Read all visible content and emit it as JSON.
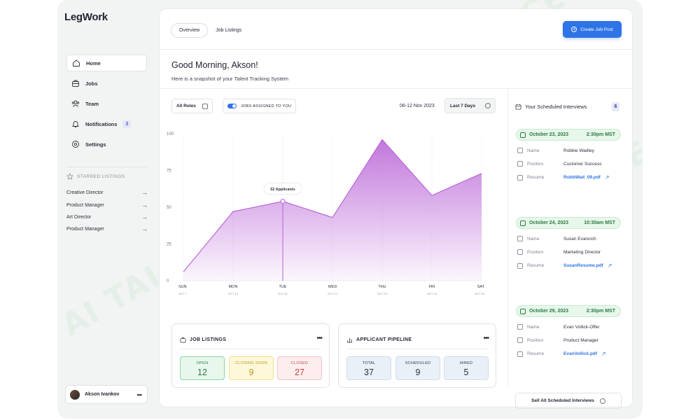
{
  "app": {
    "logo": "LegWork"
  },
  "watermark": "AI TALENT SPACE",
  "sidebar": {
    "nav": [
      {
        "label": "Home",
        "icon": "home-icon",
        "active": true
      },
      {
        "label": "Jobs",
        "icon": "briefcase-icon"
      },
      {
        "label": "Team",
        "icon": "team-icon"
      },
      {
        "label": "Notifications",
        "icon": "bell-icon",
        "badge": "3"
      },
      {
        "label": "Settings",
        "icon": "gear-icon"
      }
    ],
    "starred_title": "STARRED LISTINGS",
    "starred": [
      "Creative Director",
      "Product Manager",
      "Art Director",
      "Product Manager"
    ],
    "user": {
      "name": "Akson Ivankov"
    }
  },
  "header": {
    "tabs": [
      "Overview",
      "Job Listings"
    ],
    "create_label": "Create Job Post"
  },
  "greeting": {
    "title": "Good Morning, Akson!",
    "subtitle": "Here is a snapshot of your Talent Tracking System"
  },
  "filters": {
    "roles": "All Roles",
    "assigned": "JOBS ASSIGNED TO YOU",
    "date_range": "06-12 Nov 2023",
    "period": "Last 7 Days"
  },
  "chart_data": {
    "type": "area",
    "x": [
      "SUN",
      "MON",
      "TUE",
      "WED",
      "THU",
      "FRI",
      "SAT"
    ],
    "x_sub": [
      "OCT 7",
      "OCT 10",
      "OCT 11",
      "OCT 12",
      "OCT 13",
      "OCT 14",
      "OCT 15"
    ],
    "values": [
      6,
      47,
      54,
      43,
      96,
      58,
      73
    ],
    "ylim": [
      0,
      100
    ],
    "yticks": [
      0,
      25,
      50,
      75,
      100
    ],
    "tooltip": {
      "index": 2,
      "label": "52 Applicants"
    },
    "color": "#b75fd6"
  },
  "job_listings": {
    "title": "JOB LISTINGS",
    "stats": [
      {
        "label": "OPEN",
        "value": "12",
        "bg": "#e8f7ec",
        "border": "#8fd6a3",
        "color": "#2c7a43"
      },
      {
        "label": "CLOSING SOON",
        "value": "9",
        "bg": "#fdf8d9",
        "border": "#f0e28c",
        "color": "#b8961a"
      },
      {
        "label": "CLOSED",
        "value": "27",
        "bg": "#fdeeee",
        "border": "#f2c2c2",
        "color": "#c0474a"
      }
    ]
  },
  "pipeline": {
    "title": "APPLICANT PIPELINE",
    "stats": [
      {
        "label": "TOTAL",
        "value": "37",
        "bg": "#eaf0f8",
        "border": "#d3dcea",
        "color": "#2b303b"
      },
      {
        "label": "SCHEDULED",
        "value": "9",
        "bg": "#eaf0f8",
        "border": "#d3dcea",
        "color": "#2b303b"
      },
      {
        "label": "HIRED",
        "value": "5",
        "bg": "#eaf0f8",
        "border": "#d3dcea",
        "color": "#2b303b"
      }
    ]
  },
  "interviews": {
    "title": "Your Scheduled Interviews",
    "count": "6",
    "field_labels": {
      "name": "Name",
      "position": "Position",
      "resume": "Resume"
    },
    "items": [
      {
        "date": "October 23, 2023",
        "time": "2:30pm MST",
        "name": "Robbie Wadley",
        "position": "Customer Success",
        "resume": "RobbWad_09.pdf"
      },
      {
        "date": "October 24, 2023",
        "time": "10:30am MST",
        "name": "Susan Evancich",
        "position": "Marketing Director",
        "resume": "SusanResume.pdf"
      },
      {
        "date": "October 29, 2023",
        "time": "2:30pm MST",
        "name": "Evan Vollick-Offer",
        "position": "Product Manager",
        "resume": "EvanVollick.pdf"
      }
    ],
    "sell_label": "Sell All Scheduled Interviews"
  }
}
